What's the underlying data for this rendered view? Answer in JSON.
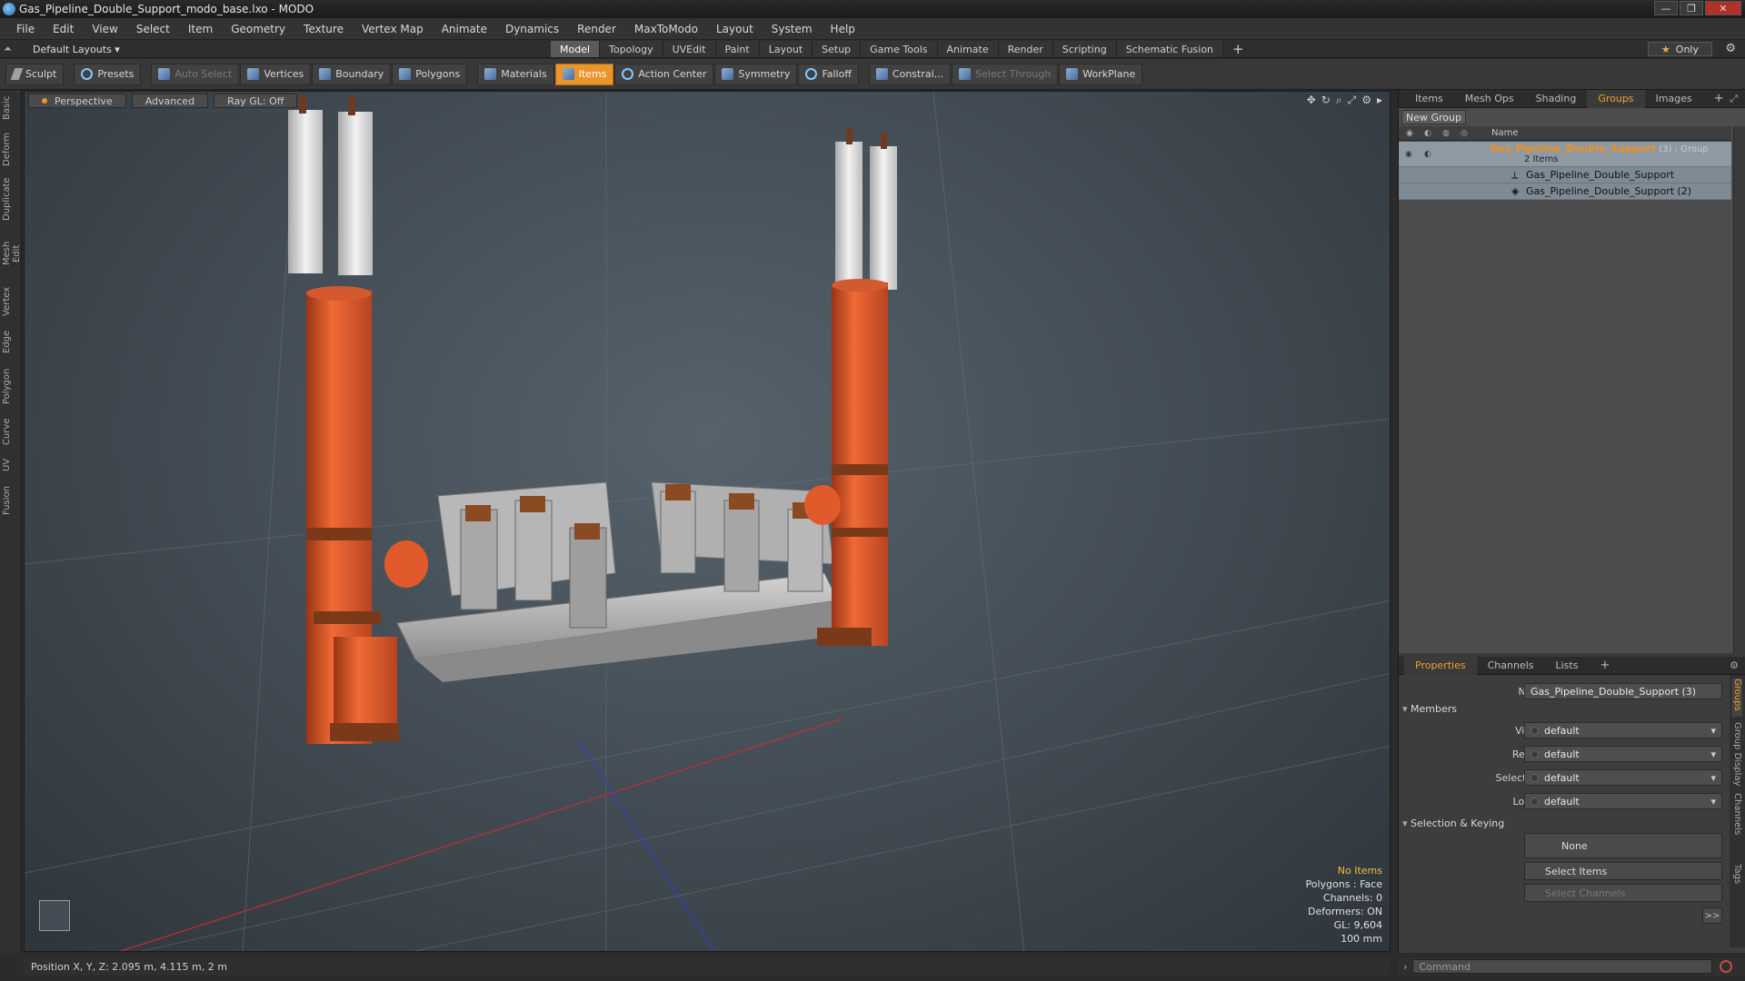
{
  "window": {
    "title": "Gas_Pipeline_Double_Support_modo_base.lxo - MODO",
    "controls": [
      "—",
      "❐",
      "✕"
    ]
  },
  "menu": [
    "File",
    "Edit",
    "View",
    "Select",
    "Item",
    "Geometry",
    "Texture",
    "Vertex Map",
    "Animate",
    "Dynamics",
    "Render",
    "MaxToModo",
    "Layout",
    "System",
    "Help"
  ],
  "layouts": {
    "label": "Default Layouts ▾"
  },
  "main_tabs": [
    {
      "label": "Model",
      "active": true
    },
    {
      "label": "Topology"
    },
    {
      "label": "UVEdit"
    },
    {
      "label": "Paint"
    },
    {
      "label": "Layout"
    },
    {
      "label": "Setup"
    },
    {
      "label": "Game Tools"
    },
    {
      "label": "Animate"
    },
    {
      "label": "Render"
    },
    {
      "label": "Scripting"
    },
    {
      "label": "Schematic Fusion"
    },
    {
      "label": "+"
    }
  ],
  "only_button": "Only",
  "toolbar": {
    "sculpt": "Sculpt",
    "presets": "Presets",
    "auto_select": "Auto Select",
    "vertices": "Vertices",
    "boundary": "Boundary",
    "polygons": "Polygons",
    "materials": "Materials",
    "items": "Items",
    "action_center": "Action Center",
    "symmetry": "Symmetry",
    "falloff": "Falloff",
    "constraints": "Constrai...",
    "select_through": "Select Through",
    "workplane": "WorkPlane"
  },
  "left_tabs": [
    "Basic",
    "Deform",
    "Duplicate",
    "Mesh Edit",
    "Vertex",
    "Edge",
    "Polygon",
    "Curve",
    "UV",
    "Fusion"
  ],
  "viewport": {
    "perspective": "Perspective",
    "advanced": "Advanced",
    "raygl": "Ray GL: Off",
    "icons": [
      "✥",
      "↻",
      "⌕",
      "⤢",
      "⚙",
      "▸"
    ],
    "info": {
      "no_items": "No Items",
      "polygons": "Polygons : Face",
      "channels": "Channels: 0",
      "deformers": "Deformers: ON",
      "gl": "GL: 9,604",
      "scale": "100 mm"
    }
  },
  "right_panel": {
    "tabs": [
      {
        "label": "Items"
      },
      {
        "label": "Mesh Ops"
      },
      {
        "label": "Shading"
      },
      {
        "label": "Groups",
        "active": true
      },
      {
        "label": "Images"
      },
      {
        "label": "+"
      }
    ],
    "new_group": "New Group",
    "name_col": "Name",
    "groups": {
      "group_name": "Gas_Pipeline_Double_Support",
      "group_suffix": "(3) : Group",
      "group_count": "2 Items",
      "children": [
        "Gas_Pipeline_Double_Support",
        "Gas_Pipeline_Double_Support (2)"
      ]
    }
  },
  "properties": {
    "tabs": [
      {
        "label": "Properties",
        "active": true
      },
      {
        "label": "Channels"
      },
      {
        "label": "Lists"
      },
      {
        "label": "+"
      }
    ],
    "name_label": "Name",
    "name_value": "Gas_Pipeline_Double_Support (3)",
    "members_section": "Members",
    "visible_label": "Visible",
    "visible_value": "default",
    "render_label": "Render",
    "render_value": "default",
    "selectable_label": "Selectable",
    "selectable_value": "default",
    "locked_label": "Locked",
    "locked_value": "default",
    "selection_section": "Selection & Keying",
    "none_btn": "None",
    "select_items": "Select Items",
    "select_channels": "Select Channels",
    "more": ">>",
    "side_tabs": [
      "Groups",
      "Group Display",
      "User Channels",
      "Tags"
    ]
  },
  "status": {
    "position": "Position X, Y, Z:   2.095 m, 4.115 m, 2 m"
  },
  "command": {
    "placeholder": "Command"
  },
  "colors": {
    "accent": "#e8962c",
    "pipe_orange": "#e05a2c",
    "group_highlight": "#f09020"
  }
}
